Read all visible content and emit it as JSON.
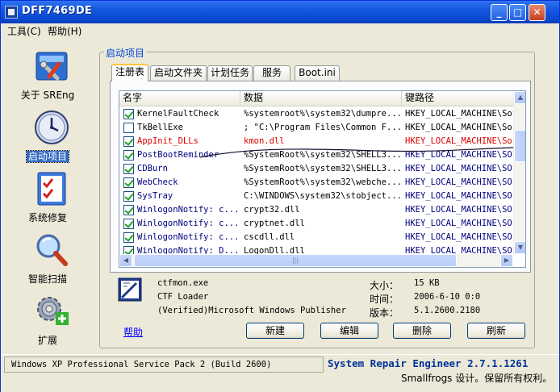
{
  "window": {
    "title": "DFF7469DE",
    "min_glyph": "_",
    "max_glyph": "□",
    "close_glyph": "✕"
  },
  "menu": {
    "tools": "工具(C)",
    "help": "帮助(H)"
  },
  "sidebar": {
    "items": [
      {
        "label": "关于 SREng",
        "icon": "tools-icon"
      },
      {
        "label": "启动项目",
        "icon": "clock-icon"
      },
      {
        "label": "系统修复",
        "icon": "checklist-icon"
      },
      {
        "label": "智能扫描",
        "icon": "magnifier-icon"
      },
      {
        "label": "扩展",
        "icon": "gear-plus-icon"
      }
    ],
    "active_index": 1
  },
  "main": {
    "group_title": "启动项目",
    "tabs": [
      "注册表",
      "启动文件夹",
      "计划任务",
      "服务",
      "Boot.ini"
    ],
    "active_tab": 0,
    "columns": [
      "名字",
      "数据",
      "键路径"
    ],
    "rows": [
      {
        "checked": true,
        "name": "KernelFaultCheck",
        "data": "%systemroot%\\system32\\dumpre...",
        "key": "HKEY_LOCAL_MACHINE\\Sof",
        "style": "normal"
      },
      {
        "checked": false,
        "name": "TkBellExe",
        "data": "; \"C:\\Program Files\\Common F...",
        "key": "HKEY_LOCAL_MACHINE\\Sof",
        "style": "normal"
      },
      {
        "checked": true,
        "name": "AppInit_DLLs",
        "data": "kmon.dll",
        "key": "HKEY_LOCAL_MACHINE\\Sof",
        "style": "red"
      },
      {
        "checked": true,
        "name": "PostBootReminder",
        "data": "%SystemRoot%\\system32\\SHELL3...",
        "key": "HKEY_LOCAL_MACHINE\\SOF",
        "style": "blue"
      },
      {
        "checked": true,
        "name": "CDBurn",
        "data": "%SystemRoot%\\system32\\SHELL3...",
        "key": "HKEY_LOCAL_MACHINE\\SOF",
        "style": "blue"
      },
      {
        "checked": true,
        "name": "WebCheck",
        "data": "%SystemRoot%\\system32\\webche...",
        "key": "HKEY_LOCAL_MACHINE\\SOF",
        "style": "blue"
      },
      {
        "checked": true,
        "name": "SysTray",
        "data": "C:\\WINDOWS\\system32\\stobject...",
        "key": "HKEY_LOCAL_MACHINE\\SOF",
        "style": "blue"
      },
      {
        "checked": true,
        "name": "WinlogonNotify: c...",
        "data": "crypt32.dll",
        "key": "HKEY_LOCAL_MACHINE\\SOF",
        "style": "blue"
      },
      {
        "checked": true,
        "name": "WinlogonNotify: c...",
        "data": "cryptnet.dll",
        "key": "HKEY_LOCAL_MACHINE\\SOF",
        "style": "blue"
      },
      {
        "checked": true,
        "name": "WinlogonNotify: c...",
        "data": "cscdll.dll",
        "key": "HKEY_LOCAL_MACHINE\\SOF",
        "style": "blue"
      },
      {
        "checked": true,
        "name": "WinlogonNotify: D...",
        "data": "LogonDll.dll",
        "key": "HKEY_LOCAL_MACHINE\\SOF",
        "style": "blue"
      }
    ],
    "details": {
      "file": "ctfmon.exe",
      "description": "CTF Loader",
      "publisher": "(Verified)Microsoft Windows Publisher",
      "size_label": "大小：",
      "size_value": "15 KB",
      "time_label": "时间：",
      "time_value": "2006-6-10 0:0",
      "version_label": "版本：",
      "version_value": "5.1.2600.2180"
    },
    "help_link": "帮助",
    "buttons": {
      "new": "新建",
      "edit": "编辑",
      "delete": "删除",
      "refresh": "刷新"
    }
  },
  "status": {
    "os": "Windows XP Professional Service Pack 2 (Build 2600)",
    "app_name": "System Repair Engineer 2.7.1.1261",
    "copyright": "Smallfrogs 设计。保留所有权利。"
  },
  "colors": {
    "title_bar": "#0a49d1",
    "group_title": "#0046d5",
    "highlight_red": "#e00000",
    "ms_blue": "#000080",
    "app_name": "#003399"
  }
}
